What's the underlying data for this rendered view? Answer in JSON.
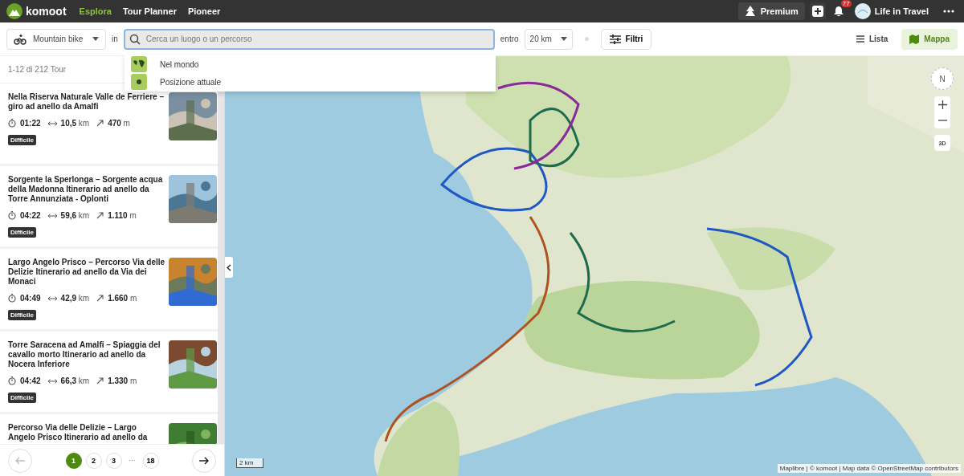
{
  "topbar": {
    "logo": "komoot",
    "nav": [
      {
        "label": "Esplora",
        "selected": true
      },
      {
        "label": "Tour Planner",
        "selected": false
      },
      {
        "label": "Pioneer",
        "selected": false
      }
    ],
    "premium": "Premium",
    "notifications": "77",
    "user": "Life in Travel"
  },
  "filters": {
    "sport": "Mountain bike",
    "in_label": "in",
    "search": {
      "placeholder": "Cerca un luogo o un percorso"
    },
    "within_label": "entro",
    "distance": "20 km",
    "filter_button": "Filtri",
    "views": [
      {
        "label": "Lista",
        "kind": "list",
        "selected": false
      },
      {
        "label": "Mappa",
        "kind": "map",
        "selected": true
      }
    ]
  },
  "suggestions": [
    {
      "label": "Nel mondo",
      "kind": "world"
    },
    {
      "label": "Posizione attuale",
      "kind": "location"
    }
  ],
  "list": {
    "count": "1-12 di 212 Tour",
    "tours": [
      {
        "title": "Nella Riserva Naturale Valle de Ferriere – giro ad anello da Amalfi",
        "time": "01:22",
        "distance": "10,5",
        "distance_unit": "km",
        "elevation": "470",
        "elevation_unit": "m",
        "difficulty": "Difficile"
      },
      {
        "title": "Sorgente la Sperlonga – Sorgente acqua della Madonna Itinerario ad anello da Torre Annunziata - Oplonti",
        "time": "04:22",
        "distance": "59,6",
        "distance_unit": "km",
        "elevation": "1.110",
        "elevation_unit": "m",
        "difficulty": "Difficile"
      },
      {
        "title": "Largo Angelo Prisco – Percorso Via delle Delizie Itinerario ad anello da Via dei Monaci",
        "time": "04:49",
        "distance": "42,9",
        "distance_unit": "km",
        "elevation": "1.660",
        "elevation_unit": "m",
        "difficulty": "Difficile"
      },
      {
        "title": "Torre Saracena ad Amalfi – Spiaggia del cavallo morto Itinerario ad anello da Nocera Inferiore",
        "time": "04:42",
        "distance": "66,3",
        "distance_unit": "km",
        "elevation": "1.330",
        "elevation_unit": "m",
        "difficulty": "Difficile"
      },
      {
        "title": "Percorso Via delle Delizie – Largo Angelo Prisco Itinerario ad anello da"
      }
    ]
  },
  "pagination": {
    "pages": [
      {
        "label": "1",
        "selected": true
      },
      {
        "label": "2",
        "selected": false
      },
      {
        "label": "3",
        "selected": false
      },
      {
        "label": "···",
        "kind": "gap"
      },
      {
        "label": "18",
        "selected": false
      }
    ]
  },
  "map": {
    "kind": "picture",
    "compass": "N",
    "three_d": "3D",
    "scale": "2 km",
    "attribution": "Maplibre | © komoot | Map data © OpenStreetMap contributors"
  }
}
